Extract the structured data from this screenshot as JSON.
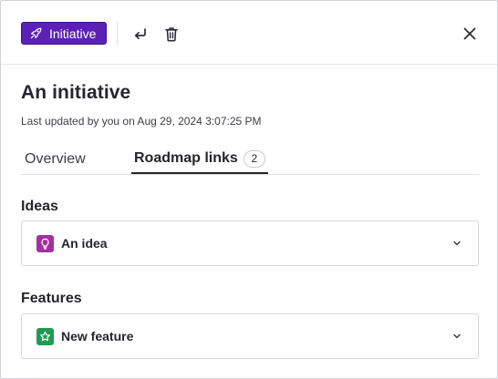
{
  "header": {
    "badge_label": "Initiative",
    "badge_icon": "rocket-icon",
    "actions": [
      "enter-icon",
      "trash-icon",
      "close-icon"
    ]
  },
  "record": {
    "title": "An initiative",
    "updated": "Last updated by you on Aug 29, 2024 3:07:25 PM"
  },
  "tabs": [
    {
      "label": "Overview"
    },
    {
      "label": "Roadmap links",
      "count": "2"
    }
  ],
  "sections": {
    "ideas": {
      "label": "Ideas",
      "item": {
        "label": "An idea",
        "icon": "lightbulb-icon",
        "color": "#a42fa0"
      }
    },
    "features": {
      "label": "Features",
      "item": {
        "label": "New feature",
        "icon": "star-icon",
        "color": "#1f9a55"
      }
    }
  },
  "colors": {
    "badge_bg": "#5b21b6",
    "text": "#24262b"
  }
}
